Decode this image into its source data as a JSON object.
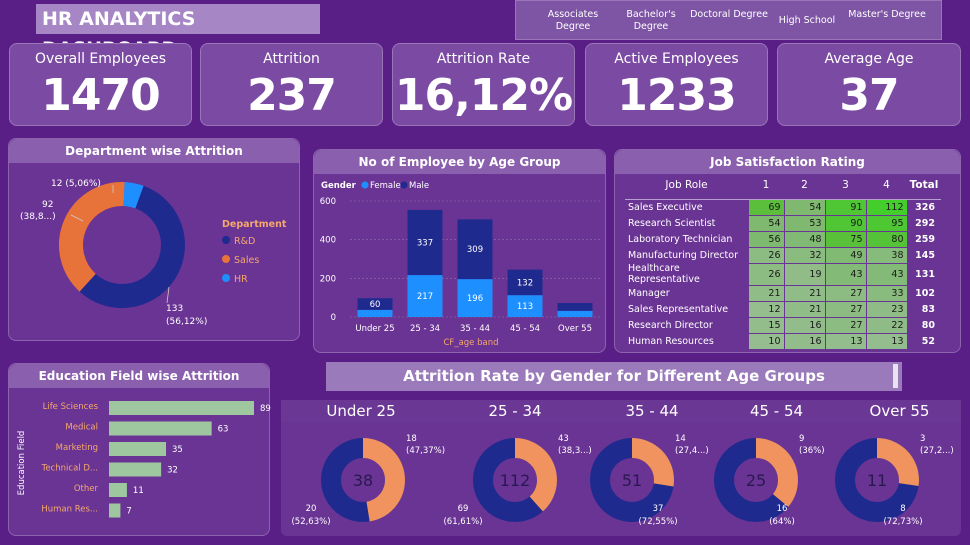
{
  "header": {
    "title": "HR ANALYTICS DASHBOARD"
  },
  "slicer": {
    "items": [
      "Associates Degree",
      "Bachelor's Degree",
      "Doctoral Degree",
      "High School",
      "Master's Degree"
    ]
  },
  "kpis": [
    {
      "label": "Overall Employees",
      "value": "1470"
    },
    {
      "label": "Attrition",
      "value": "237"
    },
    {
      "label": "Attrition Rate",
      "value": "16,12%"
    },
    {
      "label": "Active Employees",
      "value": "1233"
    },
    {
      "label": "Average Age",
      "value": "37"
    }
  ],
  "colors": {
    "background": "#5a1f86",
    "navy": "#1f2a8f",
    "orange": "#e8733a",
    "blue": "#1e8fff",
    "green": "#5ccf3a",
    "peach": "#f0935e",
    "sage": "#9fc79f"
  },
  "department": {
    "title": "Department wise Attrition",
    "legend_title": "Department",
    "legend": [
      "R&D",
      "Sales",
      "HR"
    ],
    "labels": {
      "rd_value": "133",
      "rd_pct": "(56,12%)",
      "sales_value": "92",
      "sales_pct": "(38,8...)",
      "hr_label": "12 (5,06%)"
    }
  },
  "age_group": {
    "title": "No of Employee by Age Group",
    "legend_title": "Gender",
    "legend": [
      "Female",
      "Male"
    ],
    "xlabel": "CF_age band",
    "yticks": [
      "0",
      "200",
      "400",
      "600"
    ]
  },
  "job_sat": {
    "title": "Job Satisfaction Rating",
    "headers": [
      "Job Role",
      "1",
      "2",
      "3",
      "4",
      "Total"
    ],
    "rows": [
      [
        "Sales Executive",
        "69",
        "54",
        "91",
        "112",
        "326"
      ],
      [
        "Research Scientist",
        "54",
        "53",
        "90",
        "95",
        "292"
      ],
      [
        "Laboratory Technician",
        "56",
        "48",
        "75",
        "80",
        "259"
      ],
      [
        "Manufacturing Director",
        "26",
        "32",
        "49",
        "38",
        "145"
      ],
      [
        "Healthcare Representative",
        "26",
        "19",
        "43",
        "43",
        "131"
      ],
      [
        "Manager",
        "21",
        "21",
        "27",
        "33",
        "102"
      ],
      [
        "Sales Representative",
        "12",
        "21",
        "27",
        "23",
        "83"
      ],
      [
        "Research Director",
        "15",
        "16",
        "27",
        "22",
        "80"
      ],
      [
        "Human Resources",
        "10",
        "16",
        "13",
        "13",
        "52"
      ]
    ]
  },
  "education": {
    "title": "Education Field wise Attrition",
    "axis_label": "Education Field"
  },
  "gender": {
    "title": "Attrition Rate by Gender for Different Age Groups",
    "groups": [
      {
        "age": "Under 25",
        "total": "38",
        "orange_value": "18",
        "orange_pct": "(47,37%)",
        "navy_value": "20",
        "navy_pct": "(52,63%)"
      },
      {
        "age": "25 - 34",
        "total": "112",
        "orange_value": "43",
        "orange_pct": "(38,3...)",
        "navy_value": "69",
        "navy_pct": "(61,61%)"
      },
      {
        "age": "35 - 44",
        "total": "51",
        "orange_value": "14",
        "orange_pct": "(27,4...)",
        "navy_value": "37",
        "navy_pct": "(72,55%)"
      },
      {
        "age": "45 - 54",
        "total": "25",
        "orange_value": "9",
        "orange_pct": "(36%)",
        "navy_value": "16",
        "navy_pct": "(64%)"
      },
      {
        "age": "Over 55",
        "total": "11",
        "orange_value": "3",
        "orange_pct": "(27,2...)",
        "navy_value": "8",
        "navy_pct": "(72,73%)"
      }
    ]
  },
  "chart_data": [
    {
      "type": "pie",
      "title": "Department wise Attrition",
      "categories": [
        "R&D",
        "Sales",
        "HR"
      ],
      "values": [
        133,
        92,
        12
      ],
      "legend": "right"
    },
    {
      "type": "bar",
      "title": "No of Employee by Age Group",
      "xlabel": "CF_age band",
      "ylabel": "",
      "categories": [
        "Under 25",
        "25 - 34",
        "35 - 44",
        "45 - 54",
        "Over 55"
      ],
      "series": [
        {
          "name": "Female",
          "values": [
            37,
            217,
            196,
            113,
            32
          ]
        },
        {
          "name": "Male",
          "values": [
            60,
            337,
            309,
            132,
            40
          ]
        }
      ],
      "data_labels": {
        "Female": [
          "",
          "217",
          "196",
          "113",
          ""
        ],
        "Male": [
          "60",
          "337",
          "309",
          "132",
          ""
        ]
      },
      "ylim": [
        0,
        600
      ],
      "stacked": true,
      "legend": "top-left",
      "grid": true
    },
    {
      "type": "bar",
      "title": "Education Field wise Attrition",
      "ylabel": "Education Field",
      "orientation": "horizontal",
      "categories": [
        "Life Sciences",
        "Medical",
        "Marketing",
        "Technical D...",
        "Other",
        "Human Res..."
      ],
      "values": [
        89,
        63,
        35,
        32,
        11,
        7
      ],
      "grid": false
    },
    {
      "type": "pie",
      "title": "Attrition Rate by Gender for Different Age Groups",
      "categories": [
        "Under 25",
        "25 - 34",
        "35 - 44",
        "45 - 54",
        "Over 55"
      ],
      "series": [
        {
          "values": [
            18,
            43,
            14,
            9,
            3
          ]
        },
        {
          "values": [
            20,
            69,
            37,
            16,
            8
          ]
        }
      ]
    }
  ]
}
